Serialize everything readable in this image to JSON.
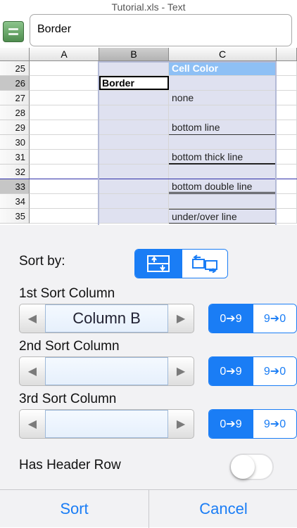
{
  "title": "Tutorial.xls - Text",
  "formula": {
    "value": "Border"
  },
  "grid": {
    "columns": [
      "A",
      "B",
      "C"
    ],
    "rows": [
      "25",
      "26",
      "27",
      "28",
      "29",
      "30",
      "31",
      "32",
      "33",
      "34",
      "35"
    ],
    "cells": {
      "c25": "Cell Color",
      "b26": "Border",
      "c27": "none",
      "c29": "bottom line",
      "c31": "bottom thick line",
      "c33": "bottom double line",
      "c35": "under/over line"
    }
  },
  "sort": {
    "sort_by_label": "Sort by:",
    "sort_by_options": [
      "rows",
      "columns"
    ],
    "sort_by_selected": "rows",
    "col1_label": "1st Sort Column",
    "col1_value": "Column B",
    "col2_label": "2nd Sort Column",
    "col2_value": "",
    "col3_label": "3rd Sort Column",
    "col3_value": "",
    "asc_label": "0➔9",
    "desc_label": "9➔0",
    "has_header_label": "Has Header Row",
    "has_header_on": false
  },
  "buttons": {
    "sort": "Sort",
    "cancel": "Cancel"
  },
  "colors": {
    "accent": "#1a7df5",
    "header_cell": "#8ec0f5",
    "selection": "#dfe1f0"
  }
}
